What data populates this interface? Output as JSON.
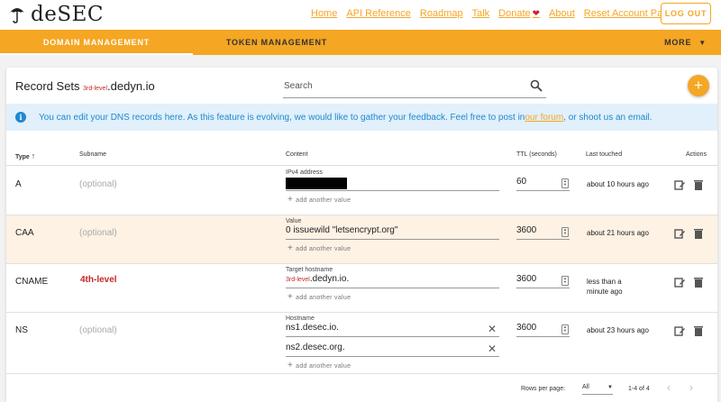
{
  "header": {
    "logo_text": "deSEC",
    "nav": [
      {
        "label": "Home"
      },
      {
        "label": "API Reference"
      },
      {
        "label": "Roadmap"
      },
      {
        "label": "Talk"
      },
      {
        "label": "Donate"
      },
      {
        "label": "About"
      },
      {
        "label": "Reset Account Password"
      }
    ],
    "logout_label": "LOG OUT"
  },
  "tabs": {
    "domain": "DOMAIN MANAGEMENT",
    "token": "TOKEN MANAGEMENT",
    "more": "MORE"
  },
  "card": {
    "title_prefix": "Record Sets ",
    "title_level": "3rd-level",
    "title_domain": ".dedyn.io",
    "search_placeholder": "Search",
    "info_text": "You can edit your DNS records here. As this feature is evolving, we would like to gather your feedback. Feel free to post in ",
    "info_link": "our forum",
    "info_text_end": ", or shoot us an email."
  },
  "columns": {
    "type": "Type",
    "subname": "Subname",
    "content": "Content",
    "ttl": "TTL (seconds)",
    "touched": "Last touched",
    "actions": "Actions"
  },
  "rows": [
    {
      "type": "A",
      "subname": "(optional)",
      "content_label": "IPv4 address",
      "content_values": [
        ""
      ],
      "ttl": "60",
      "touched": "about 10 hours ago"
    },
    {
      "type": "CAA",
      "subname": "(optional)",
      "content_label": "Value",
      "content_values": [
        "0 issuewild \"letsencrypt.org\""
      ],
      "ttl": "3600",
      "touched": "about 21 hours ago"
    },
    {
      "type": "CNAME",
      "subname": "4th-level",
      "content_label": "Target hostname",
      "content_level": "3rd-level",
      "content_values": [
        ".dedyn.io."
      ],
      "ttl": "3600",
      "touched": "less than a minute ago"
    },
    {
      "type": "NS",
      "subname": "(optional)",
      "content_label": "Hostname",
      "content_values": [
        "ns1.desec.io.",
        "ns2.desec.org."
      ],
      "ttl": "3600",
      "touched": "about 23 hours ago"
    }
  ],
  "add_value_label": "add another value",
  "footer": {
    "rows_per_page_label": "Rows per page:",
    "rows_per_page_value": "All",
    "range": "1-4 of 4"
  },
  "colors": {
    "accent": "#f5a623",
    "info": "#1e88d0",
    "info_bg": "#e1f0fb",
    "row_highlight": "#fdf2e4",
    "level_red": "#c62828"
  }
}
